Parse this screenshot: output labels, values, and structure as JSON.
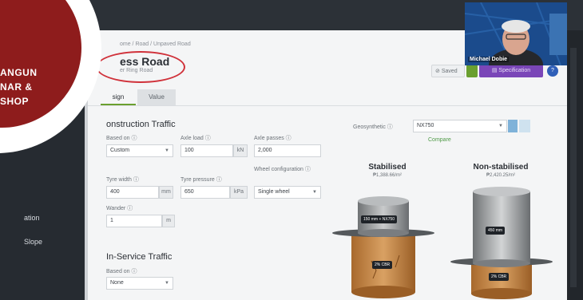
{
  "promo": {
    "line1": "ANGUN",
    "line2": "NAR &",
    "line3": "SHOP"
  },
  "sidebar": {
    "items": [
      {
        "label": "ation"
      },
      {
        "label": "Slope"
      }
    ]
  },
  "breadcrumb": "ome / Road / Unpaved Road",
  "road": {
    "title": "ess Road",
    "subtitle": "er Ring Road"
  },
  "tabs": [
    {
      "label": "sign"
    },
    {
      "label": "Value"
    }
  ],
  "actions": {
    "saved": "Saved",
    "specification": "Specification",
    "help": "?"
  },
  "webcam": {
    "name": "Michael Dobie"
  },
  "construction": {
    "title": "onstruction Traffic",
    "based_on": {
      "label": "Based on ⓘ",
      "value": "Custom"
    },
    "axle_load": {
      "label": "Axle load ⓘ",
      "value": "100",
      "unit": "kN"
    },
    "axle_passes": {
      "label": "Axle passes ⓘ",
      "value": "2,000"
    },
    "tyre_width": {
      "label": "Tyre width ⓘ",
      "value": "400",
      "unit": "mm"
    },
    "tyre_pressure": {
      "label": "Tyre pressure ⓘ",
      "value": "650",
      "unit": "kPa"
    },
    "wheel_config": {
      "label": "Wheel configuration ⓘ",
      "value": "Single wheel"
    },
    "wander": {
      "label": "Wander ⓘ",
      "value": "1",
      "unit": "m"
    }
  },
  "in_service": {
    "title": "In-Service Traffic",
    "based_on": {
      "label": "Based on ⓘ",
      "value": "None"
    }
  },
  "geosynthetic": {
    "label": "Geosynthetic ⓘ",
    "value": "NX750",
    "compare": "Compare"
  },
  "stabilised": {
    "title": "Stabilised",
    "cost": "₱1,388.66/m²",
    "layer_badge": "150 mm + NX750",
    "base_badge": "2% CBR"
  },
  "non_stabilised": {
    "title": "Non-stabilised",
    "cost": "₱2,420.25/m²",
    "layer_badge": "450 mm",
    "base_badge": "2% CBR"
  },
  "colors": {
    "promo_red": "#8e1c1c",
    "accent_green": "#6a9f2f",
    "spec_purple": "#7a46b8",
    "ring_red": "#d0313a"
  }
}
